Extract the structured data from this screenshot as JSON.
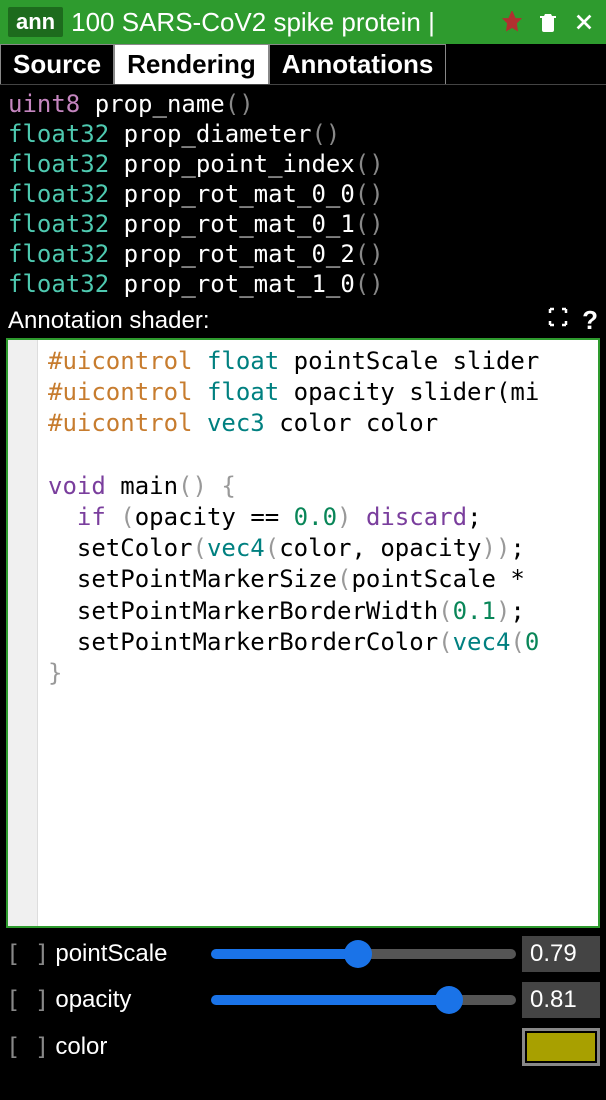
{
  "header": {
    "badge": "ann",
    "title": "100 SARS-CoV2 spike protein |"
  },
  "tabs": [
    {
      "label": "Source",
      "active": false
    },
    {
      "label": "Rendering",
      "active": true
    },
    {
      "label": "Annotations",
      "active": false
    }
  ],
  "props": [
    {
      "type": "uint8",
      "name": "prop_name"
    },
    {
      "type": "float32",
      "name": "prop_diameter"
    },
    {
      "type": "float32",
      "name": "prop_point_index"
    },
    {
      "type": "float32",
      "name": "prop_rot_mat_0_0"
    },
    {
      "type": "float32",
      "name": "prop_rot_mat_0_1"
    },
    {
      "type": "float32",
      "name": "prop_rot_mat_0_2"
    },
    {
      "type": "float32",
      "name": "prop_rot_mat_1_0"
    }
  ],
  "shader_label": "Annotation shader:",
  "help_icon": "?",
  "shader_lines": [
    [
      {
        "t": "kw-ui",
        "v": "#uicontrol"
      },
      {
        "t": "sp",
        "v": " "
      },
      {
        "t": "kw-type",
        "v": "float"
      },
      {
        "t": "sp",
        "v": " "
      },
      {
        "t": "ident",
        "v": "pointScale slider"
      }
    ],
    [
      {
        "t": "kw-ui",
        "v": "#uicontrol"
      },
      {
        "t": "sp",
        "v": " "
      },
      {
        "t": "kw-type",
        "v": "float"
      },
      {
        "t": "sp",
        "v": " "
      },
      {
        "t": "ident",
        "v": "opacity slider(mi"
      }
    ],
    [
      {
        "t": "kw-ui",
        "v": "#uicontrol"
      },
      {
        "t": "sp",
        "v": " "
      },
      {
        "t": "kw-type",
        "v": "vec3"
      },
      {
        "t": "sp",
        "v": " "
      },
      {
        "t": "ident",
        "v": "color color"
      }
    ],
    [],
    [
      {
        "t": "kw-void",
        "v": "void"
      },
      {
        "t": "sp",
        "v": " "
      },
      {
        "t": "fn",
        "v": "main"
      },
      {
        "t": "brace",
        "v": "()"
      },
      {
        "t": "sp",
        "v": " "
      },
      {
        "t": "brace",
        "v": "{"
      }
    ],
    [
      {
        "t": "sp",
        "v": "  "
      },
      {
        "t": "kw-ctrl",
        "v": "if"
      },
      {
        "t": "sp",
        "v": " "
      },
      {
        "t": "brace",
        "v": "("
      },
      {
        "t": "ident",
        "v": "opacity "
      },
      {
        "t": "op",
        "v": "== "
      },
      {
        "t": "num",
        "v": "0.0"
      },
      {
        "t": "brace",
        "v": ")"
      },
      {
        "t": "sp",
        "v": " "
      },
      {
        "t": "kw-ctrl",
        "v": "discard"
      },
      {
        "t": "op",
        "v": ";"
      }
    ],
    [
      {
        "t": "sp",
        "v": "  "
      },
      {
        "t": "fn",
        "v": "setColor"
      },
      {
        "t": "brace",
        "v": "("
      },
      {
        "t": "kw-type",
        "v": "vec4"
      },
      {
        "t": "brace",
        "v": "("
      },
      {
        "t": "ident",
        "v": "color"
      },
      {
        "t": "op",
        "v": ", "
      },
      {
        "t": "ident",
        "v": "opacity"
      },
      {
        "t": "brace",
        "v": "))"
      },
      {
        "t": "op",
        "v": ";"
      }
    ],
    [
      {
        "t": "sp",
        "v": "  "
      },
      {
        "t": "fn",
        "v": "setPointMarkerSize"
      },
      {
        "t": "brace",
        "v": "("
      },
      {
        "t": "ident",
        "v": "pointScale "
      },
      {
        "t": "op",
        "v": "*"
      }
    ],
    [
      {
        "t": "sp",
        "v": "  "
      },
      {
        "t": "fn",
        "v": "setPointMarkerBorderWidth"
      },
      {
        "t": "brace",
        "v": "("
      },
      {
        "t": "num",
        "v": "0.1"
      },
      {
        "t": "brace",
        "v": ")"
      },
      {
        "t": "op",
        "v": ";"
      }
    ],
    [
      {
        "t": "sp",
        "v": "  "
      },
      {
        "t": "fn",
        "v": "setPointMarkerBorderColor"
      },
      {
        "t": "brace",
        "v": "("
      },
      {
        "t": "kw-type",
        "v": "vec4"
      },
      {
        "t": "brace",
        "v": "("
      },
      {
        "t": "num",
        "v": "0"
      }
    ],
    [
      {
        "t": "brace",
        "v": "}"
      }
    ]
  ],
  "controls": {
    "reset": "[ ]",
    "items": [
      {
        "label": "pointScale",
        "value": "0.79",
        "pct": 48
      },
      {
        "label": "opacity",
        "value": "0.81",
        "pct": 81
      }
    ],
    "color": {
      "label": "color",
      "hex": "#a8a000"
    }
  }
}
